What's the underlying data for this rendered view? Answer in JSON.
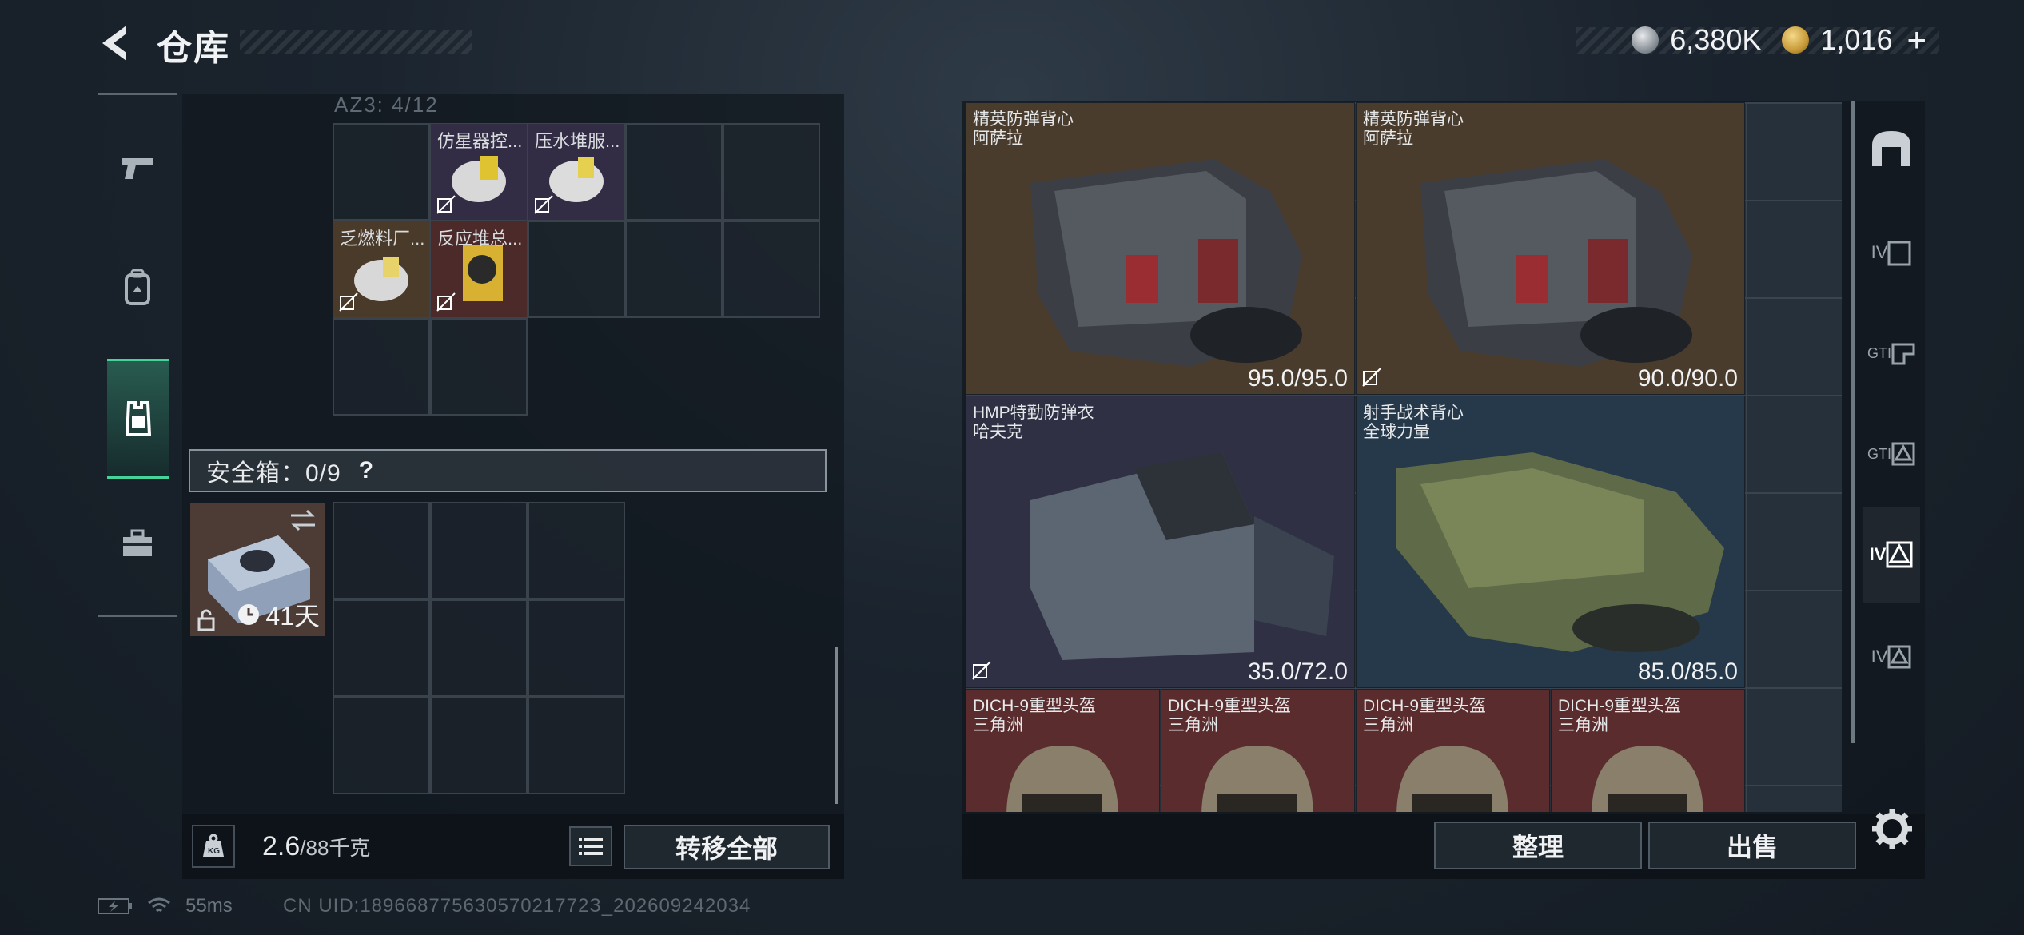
{
  "header": {
    "title": "仓库",
    "silver_amount": "6,380K",
    "gold_amount": "1,016",
    "add_symbol": "+"
  },
  "left_rail": {
    "icons": [
      "pistol-icon",
      "backpack-icon",
      "vest-icon",
      "toolbox-icon"
    ],
    "active_index": 2
  },
  "container": {
    "label": "AZ3: 4/12",
    "items": [
      {
        "name": "仿星器控...",
        "color": "purple"
      },
      {
        "name": "压水堆服...",
        "color": "purple"
      },
      {
        "name": "乏燃料厂...",
        "color": "brown"
      },
      {
        "name": "反应堆总...",
        "color": "red"
      }
    ]
  },
  "safe_box": {
    "label": "安全箱：0/9",
    "help": "?",
    "days": "41天"
  },
  "bottom_left": {
    "weight_value": "2.6",
    "weight_capacity": "/88千克",
    "transfer_label": "转移全部"
  },
  "stash": {
    "items": [
      {
        "name": "精英防弹背心",
        "brand": "阿萨拉",
        "durability": "95.0/95.0",
        "color": "#4a3c2d"
      },
      {
        "name": "精英防弹背心",
        "brand": "阿萨拉",
        "durability": "90.0/90.0",
        "color": "#4a3c2d"
      },
      {
        "name": "HMP特勤防弹衣",
        "brand": "哈夫克",
        "durability": "35.0/72.0",
        "color": "#2f3044"
      },
      {
        "name": "射手战术背心",
        "brand": "全球力量",
        "durability": "85.0/85.0",
        "color": "#26394a"
      },
      {
        "name": "DICH-9重型头盔",
        "brand": "三角洲"
      },
      {
        "name": "DICH-9重型头盔",
        "brand": "三角洲"
      },
      {
        "name": "DICH-9重型头盔",
        "brand": "三角洲"
      },
      {
        "name": "DICH-9重型头盔",
        "brand": "三角洲"
      }
    ],
    "sort_label": "整理",
    "sell_label": "出售"
  },
  "filters": {
    "labels": [
      "IV",
      "GTI",
      "GTI",
      "IV",
      "IV"
    ],
    "active_index": 4
  },
  "status": {
    "ping": "55ms",
    "uid": "CN UID:18966877563057021772З_202609242034"
  }
}
